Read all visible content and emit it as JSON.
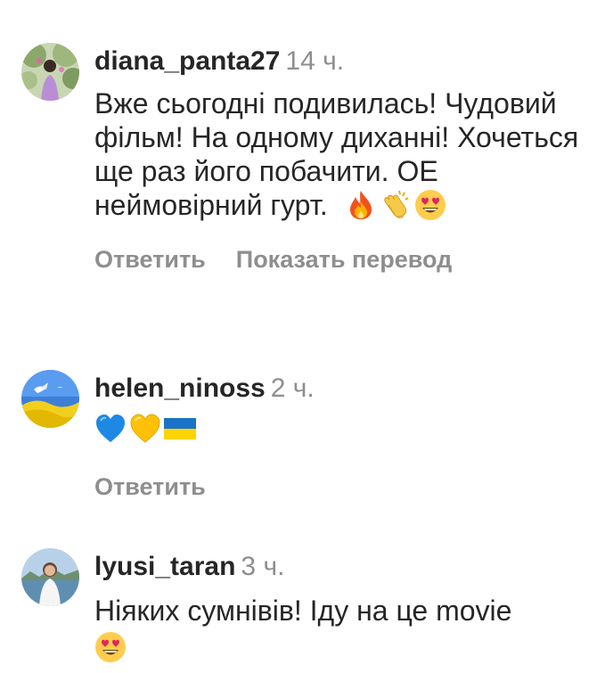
{
  "comments": [
    {
      "username": "diana_panta27",
      "time": "14 ч.",
      "text": "Вже сьогодні подивилась! Чудовий фільм! На одному диханні! Хочеться ще раз його побачити. ОЕ неймовірний гурт.",
      "emoji": [
        "fire-emoji",
        "clapping-hands-emoji",
        "heart-eyes-emoji"
      ],
      "reply_label": "Ответить",
      "translate_label": "Показать перевод"
    },
    {
      "username": "helen_ninoss",
      "time": "2 ч.",
      "emoji": [
        "blue-heart-emoji",
        "yellow-heart-emoji",
        "ukraine-flag-emoji"
      ],
      "reply_label": "Ответить"
    },
    {
      "username": "lyusi_taran",
      "time": "3 ч.",
      "text": "Ніяких сумнівів! Іду на це movie",
      "emoji": [
        "heart-eyes-emoji"
      ]
    }
  ],
  "colors": {
    "text": "#262626",
    "secondary": "#8e8e8e",
    "background": "#ffffff"
  }
}
